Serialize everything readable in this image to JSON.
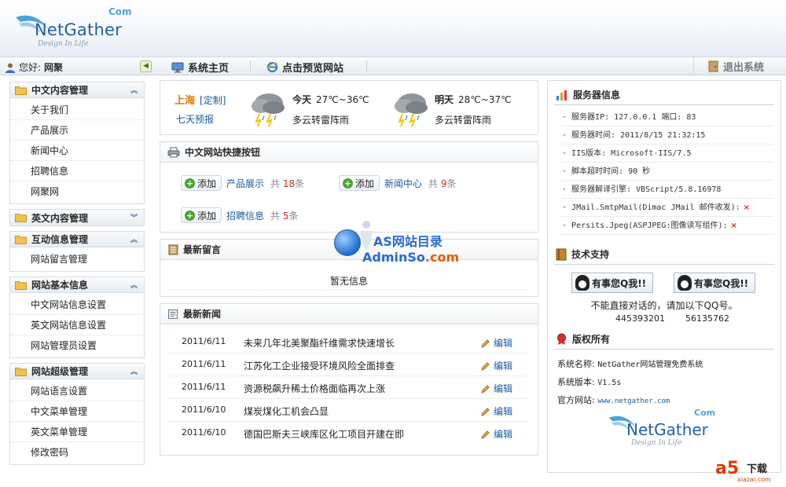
{
  "header": {
    "logo_text": "NetGather",
    "logo_com": "Com",
    "logo_tagline": "Design In Life"
  },
  "navbar": {
    "greeting": "您好:",
    "username": "网聚",
    "home": "系统主页",
    "preview": "点击预览网站",
    "logout": "退出系统"
  },
  "sidebar": {
    "groups": [
      {
        "title": "中文内容管理",
        "items": [
          "关于我们",
          "产品展示",
          "新闻中心",
          "招聘信息",
          "网聚网"
        ]
      },
      {
        "title": "英文内容管理",
        "items": []
      },
      {
        "title": "互动信息管理",
        "items": [
          "网站留言管理"
        ]
      },
      {
        "title": "网站基本信息",
        "items": [
          "中文网站信息设置",
          "英文网站信息设置",
          "网站管理员设置"
        ]
      },
      {
        "title": "网站超级管理",
        "items": [
          "网站语言设置",
          "中文菜单管理",
          "英文菜单管理",
          "修改密码"
        ]
      }
    ]
  },
  "weather": {
    "city": "上海",
    "customize": "[定制]",
    "forecast": "七天预报",
    "today_label": "今天",
    "today_temp": "27℃~36℃",
    "today_desc": "多云转雷阵雨",
    "tomorrow_label": "明天",
    "tomorrow_temp": "28℃~37℃",
    "tomorrow_desc": "多云转雷阵雨"
  },
  "quick": {
    "title": "中文网站快捷按钮",
    "add_label": "添加",
    "items": [
      {
        "name": "产品展示",
        "prefix": "共",
        "count": "18",
        "suffix": "条"
      },
      {
        "name": "新闻中心",
        "prefix": "共",
        "count": "9",
        "suffix": "条"
      },
      {
        "name": "招聘信息",
        "prefix": "共",
        "count": "5",
        "suffix": "条"
      }
    ]
  },
  "messages": {
    "title": "最新留言",
    "empty": "暂无信息"
  },
  "news": {
    "title": "最新新闻",
    "edit_label": "编辑",
    "rows": [
      {
        "date": "2011/6/11",
        "title": "未来几年北美聚酯纤维需求快速增长"
      },
      {
        "date": "2011/6/11",
        "title": "江苏化工企业接受环境风险全面排查"
      },
      {
        "date": "2011/6/11",
        "title": "资源税飙升稀土价格面临再次上涨"
      },
      {
        "date": "2011/6/10",
        "title": "煤炭煤化工机会凸显"
      },
      {
        "date": "2011/6/10",
        "title": "德国巴斯夫三峡库区化工项目开建在即"
      }
    ]
  },
  "watermark": {
    "line1": "AS网站目录",
    "line2a": "Admin",
    "line2b": "So",
    "line2c": ".com"
  },
  "server": {
    "title": "服务器信息",
    "ip": "服务器IP: 127.0.0.1  端口: 83",
    "time": "服务器时间: 2011/8/15 21:32:15",
    "iis": "IIS版本: Microsoft-IIS/7.5",
    "timeout": "脚本超时时间: 90 秒",
    "engine": "服务器解译引擎: VBScript/5.8.16978",
    "jmail": "JMail.SmtpMail(Dimac JMail 邮件收发):",
    "persits": "Persits.Jpeg(ASPJPEG:图像读写组件):",
    "unavailable_mark": "×"
  },
  "support": {
    "title": "技术支持",
    "qq_button": "有事您Q我!!",
    "note": "不能直接对话的，请加以下QQ号。",
    "qq1": "445393201",
    "qq2": "56135762"
  },
  "copyright": {
    "title": "版权所有",
    "name_label": "系统名称:",
    "name_value": "NetGather网站管理免费系统",
    "version_label": "系统版本:",
    "version_value": "V1.5s",
    "site_label": "官方网站:",
    "site_value": "www.netgather.com"
  },
  "a5": {
    "mark": "a5",
    "label": "下载",
    "site": "xiazai.com"
  },
  "colors": {
    "link": "#1a5ca0",
    "accent_orange": "#e07b00",
    "count_red": "#c62828",
    "border": "#d6dde5"
  }
}
